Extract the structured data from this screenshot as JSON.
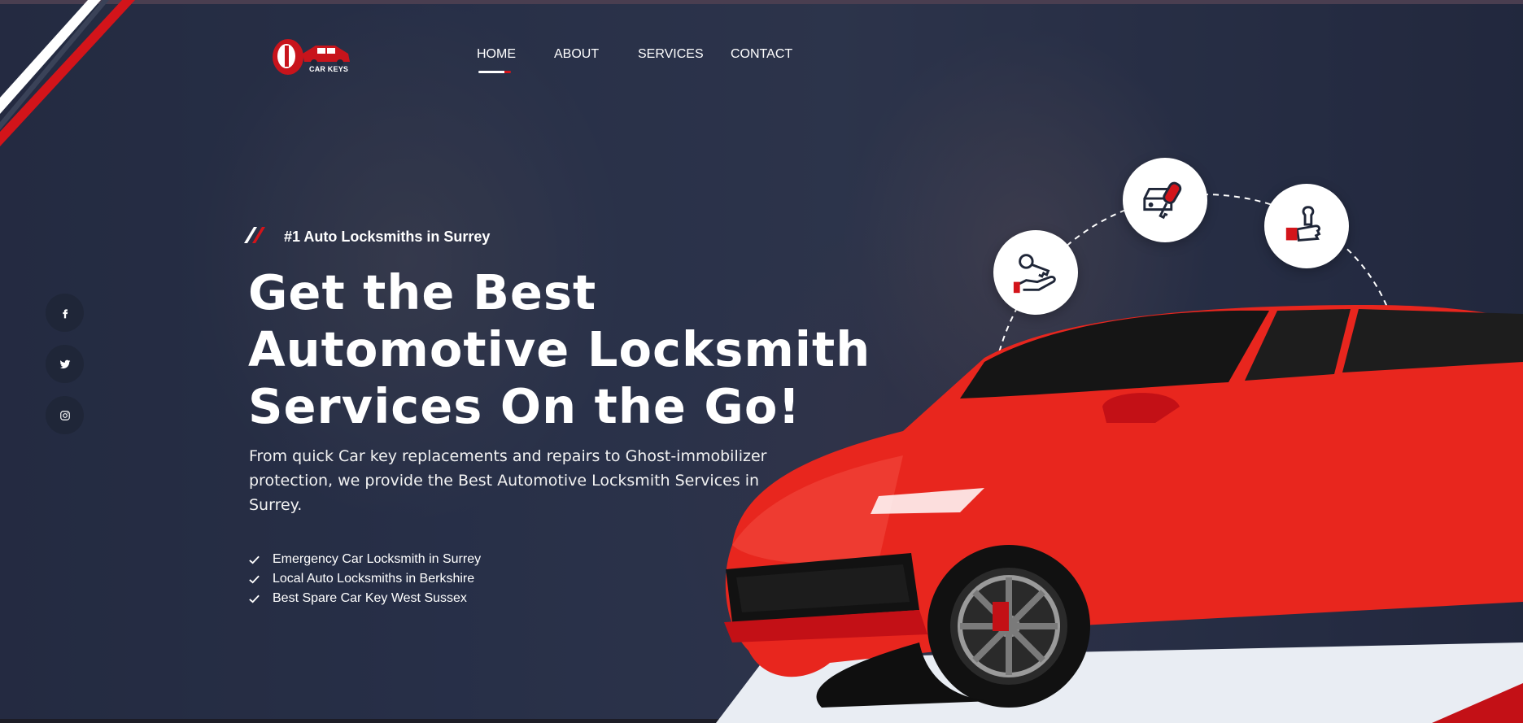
{
  "brand": {
    "logo_text": "CAR KEYS"
  },
  "nav": {
    "items": [
      "HOME",
      "ABOUT",
      "SERVICES",
      "CONTACT"
    ],
    "active": "HOME"
  },
  "social": {
    "icons": [
      "facebook-icon",
      "twitter-icon",
      "instagram-icon"
    ]
  },
  "hero": {
    "tagline": "#1 Auto Locksmiths in Surrey",
    "headline": [
      "Get the Best",
      "Automotive Locksmith",
      "Services On the Go!"
    ],
    "description": "From quick Car key replacements and repairs to Ghost-immobilizer protection, we provide the Best Automotive Locksmith Services in Surrey.",
    "bullets": [
      "Emergency Car Locksmith in Surrey",
      "Local Auto Locksmiths in Berkshire",
      "Best Spare Car Key West Sussex"
    ]
  },
  "feature_icons": [
    "key-in-hand-icon",
    "car-key-fob-icon",
    "repair-wrench-icon"
  ],
  "colors": {
    "accent": "#d3141a",
    "navy": "#1f2638",
    "car_red": "#e8261e"
  }
}
